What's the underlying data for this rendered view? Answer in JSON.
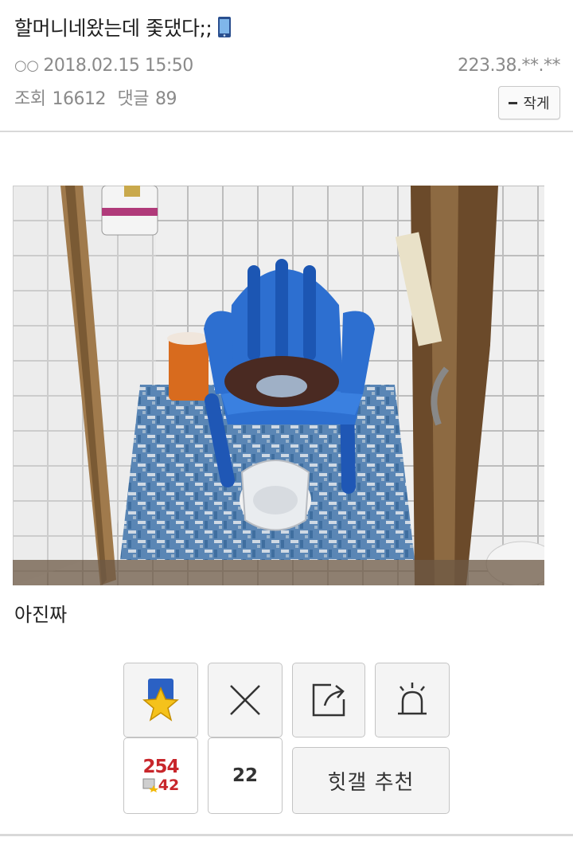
{
  "post": {
    "title": "할머니네왔는데 좇댔다;;",
    "author_mark": "○○",
    "date": "2018.02.15 15:50",
    "ip": "223.38.**.**",
    "views_label": "조회",
    "views": "16612",
    "comments_label": "댓글",
    "comments": "89",
    "font_button": "작게",
    "caption": "아진짜"
  },
  "actions": {
    "recommend_count": "254",
    "fixed_recommend_count": "42",
    "downvote_count": "22",
    "hitgall_label": "힛갤 추천"
  },
  "colors": {
    "accent_red": "#c8262b",
    "chair_blue": "#2d6fd0",
    "border": "#c4c4c4"
  },
  "icons": [
    "mobile-phone-icon",
    "star-icon",
    "close-x-icon",
    "share-icon",
    "siren-icon",
    "fixed-star-icon"
  ]
}
